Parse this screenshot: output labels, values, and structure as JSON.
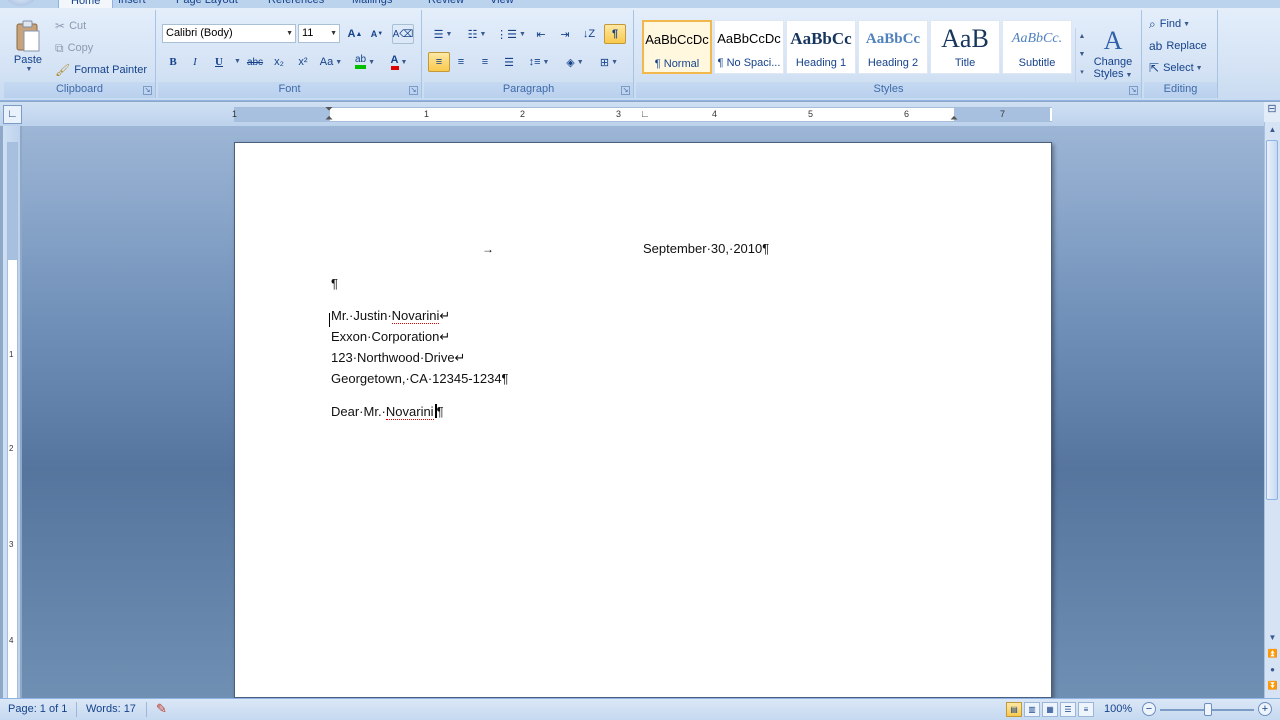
{
  "tabs": [
    "Home",
    "Insert",
    "Page Layout",
    "References",
    "Mailings",
    "Review",
    "View"
  ],
  "clipboard": {
    "label": "Clipboard",
    "paste": "Paste",
    "cut": "Cut",
    "copy": "Copy",
    "format_painter": "Format Painter"
  },
  "font": {
    "label": "Font",
    "family": "Calibri (Body)",
    "size": "11",
    "grow": "A",
    "shrink": "A",
    "bold": "B",
    "italic": "I",
    "underline": "U",
    "strike": "abc",
    "subscript": "x₂",
    "superscript": "x²",
    "change_case": "Aa",
    "font_color": "A",
    "highlight_color": "#00c000",
    "font_color_value": "#e00000"
  },
  "paragraph": {
    "label": "Paragraph",
    "show_marks": "¶"
  },
  "styles": {
    "label": "Styles",
    "items": [
      {
        "sample": "AaBbCcDc",
        "name": "¶ Normal",
        "selected": true
      },
      {
        "sample": "AaBbCcDc",
        "name": "¶ No Spaci...",
        "selected": false
      },
      {
        "sample": "AaBbCc",
        "name": "Heading 1",
        "selected": false
      },
      {
        "sample": "AaBbCc",
        "name": "Heading 2",
        "selected": false
      },
      {
        "sample": "AaB",
        "name": "Title",
        "selected": false
      },
      {
        "sample": "AaBbCc.",
        "name": "Subtitle",
        "selected": false
      }
    ],
    "change_styles_line1": "Change",
    "change_styles_line2": "Styles"
  },
  "editing": {
    "label": "Editing",
    "find": "Find",
    "replace": "Replace",
    "select": "Select"
  },
  "ruler": {
    "numbers": [
      "1",
      "1",
      "2",
      "3",
      "4",
      "5",
      "6",
      "7"
    ],
    "vnumbers": [
      "1",
      "2",
      "3",
      "4"
    ]
  },
  "document": {
    "date": "September·30,·2010¶",
    "empty_para": "¶",
    "line1_a": "Mr.·Justin·",
    "line1_b": "Novarini",
    "line1_c": "↵",
    "line2": "Exxon·Corporation↵",
    "line3": "123·Northwood·Drive↵",
    "line4": "Georgetown,·CA·12345-1234¶",
    "line5_a": "Dear·Mr.·",
    "line5_b": "Novarini",
    "line5_c": "¶",
    "tab_mark": "→"
  },
  "status": {
    "page": "Page: 1 of 1",
    "words": "Words: 17",
    "zoom": "100%"
  }
}
